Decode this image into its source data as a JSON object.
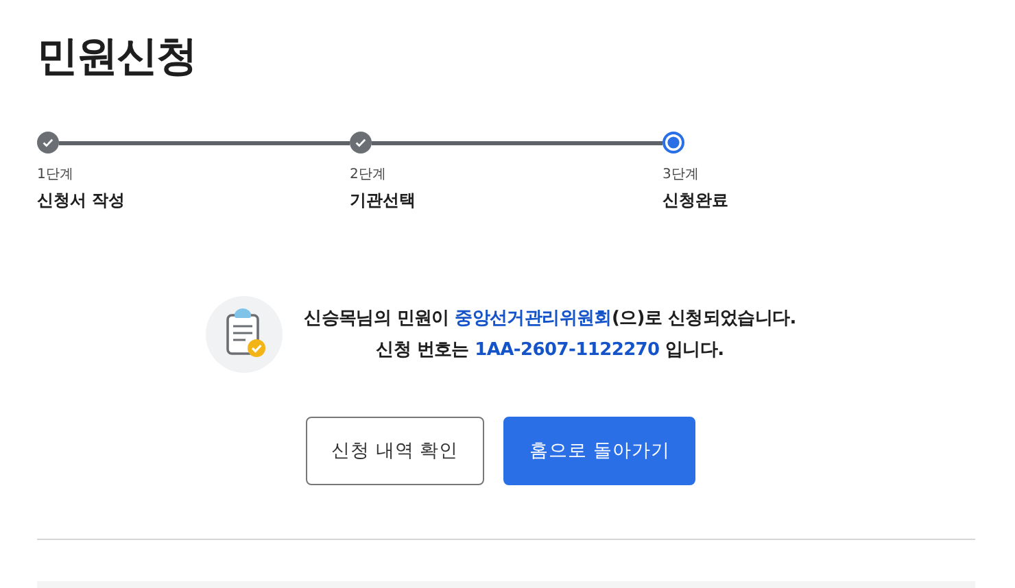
{
  "title": "민원신청",
  "steps": [
    {
      "number": "1단계",
      "label": "신청서 작성",
      "kind": "done"
    },
    {
      "number": "2단계",
      "label": "기관선택",
      "kind": "done"
    },
    {
      "number": "3단계",
      "label": "신청완료",
      "kind": "current"
    }
  ],
  "message": {
    "lines": [
      [
        {
          "text": "신승목님의 민원이 ",
          "highlight": false
        },
        {
          "text": "중앙선거관리위원회",
          "highlight": true
        },
        {
          "text": "(으)로 신청되었습니다.",
          "highlight": false
        }
      ],
      [
        {
          "text": "신청 번호는 ",
          "highlight": false
        },
        {
          "text": "1AA-2607-1122270",
          "highlight": true
        },
        {
          "text": " 입니다.",
          "highlight": false
        }
      ]
    ]
  },
  "buttons": [
    {
      "label": "신청 내역 확인",
      "kind": "secondary"
    },
    {
      "label": "홈으로 돌아가기",
      "kind": "primary"
    }
  ]
}
